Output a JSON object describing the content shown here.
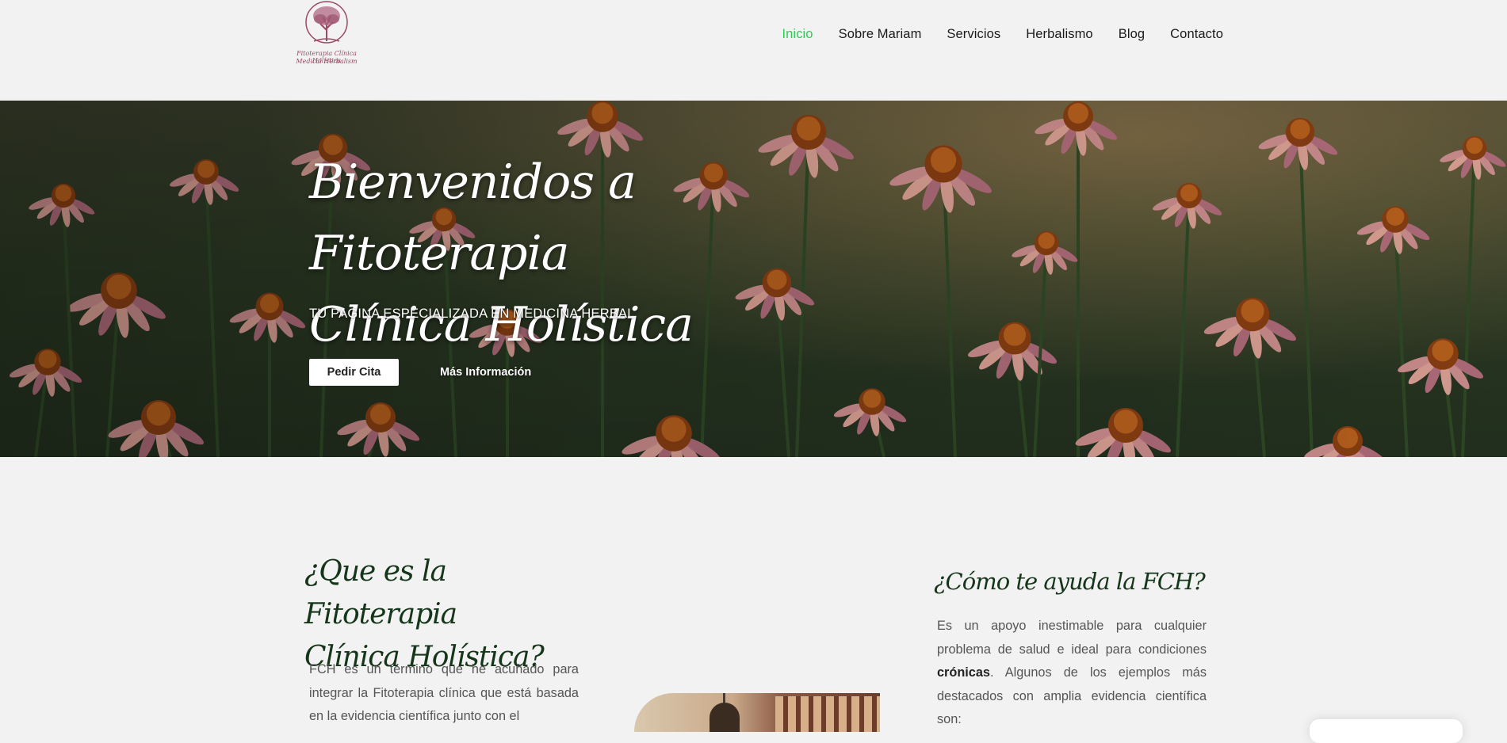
{
  "header": {
    "logo": {
      "line1": "Fitoterapia Clínica Holística",
      "line2": "Medical Herbalism",
      "icon": "tree-icon"
    },
    "nav": [
      {
        "label": "Inicio",
        "active": true
      },
      {
        "label": "Sobre Mariam",
        "active": false
      },
      {
        "label": "Servicios",
        "active": false
      },
      {
        "label": "Herbalismo",
        "active": false
      },
      {
        "label": "Blog",
        "active": false
      },
      {
        "label": "Contacto",
        "active": false
      }
    ]
  },
  "hero": {
    "title_line1": "Bienvenidos a Fitoterapia",
    "title_line2": "Clínica Holística",
    "subtitle": "TU PAGINA ESPECIALIZADA EN MEDICINA HERBAL",
    "primary_button": "Pedir Cita",
    "secondary_button": "Más Información",
    "background": "echinacea-flowers-image"
  },
  "section_left": {
    "heading_line1": "¿Que es la Fitoterapia",
    "heading_line2": "Clínica Holística?",
    "paragraph": "FCH es un término que he acuñado para integrar la Fitoterapia clínica que está basada en la evidencia científica junto con el"
  },
  "section_right": {
    "heading": "¿Cómo te ayuda la FCH?",
    "paragraph_start": "Es un apoyo inestimable para cualquier problema de salud e ideal para condiciones ",
    "paragraph_bold": "crónicas",
    "paragraph_end": ". Algunos de los ejemplos más destacados con amplia evidencia científica son:"
  },
  "colors": {
    "accent_active": "#2ecc55",
    "heading_green": "#15361a",
    "logo_pink": "#9a4a66",
    "background": "#f2f2f2"
  }
}
